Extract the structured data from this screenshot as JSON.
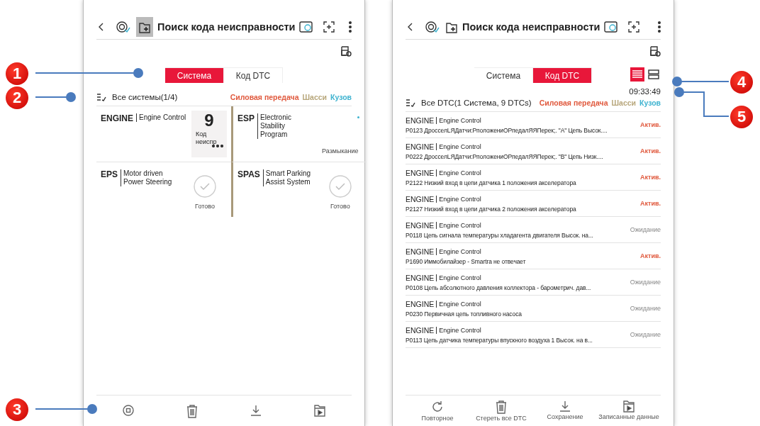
{
  "screens": [
    {
      "title": "Поиск кода неисправности",
      "doc_icon_highlighted": true,
      "tabs": [
        {
          "label": "Система",
          "selected": true
        },
        {
          "label": "Код DTC",
          "selected": false
        }
      ],
      "summary": "Все системы(1/4)",
      "categories": [
        {
          "label": "Силовая передача",
          "color": "#e0583c"
        },
        {
          "label": "Шасси",
          "color": "#b7a67a"
        },
        {
          "label": "Кузов",
          "color": "#3cb2cf"
        }
      ],
      "systems": [
        {
          "kind": "count",
          "code": "ENGINE",
          "name": "Engine Control",
          "count": "9",
          "caption": "Код неиспр"
        },
        {
          "kind": "status",
          "code": "ESP",
          "name": "Electronic Stability Program",
          "status": "Размыкание"
        },
        {
          "kind": "ready",
          "code": "EPS",
          "name": "Motor driven Power Steering",
          "status": "Готово"
        },
        {
          "kind": "ready",
          "code": "SPAS",
          "name": "Smart Parking Assist System",
          "status": "Готово"
        }
      ],
      "toolbar": [
        {
          "kind": "stop"
        },
        {
          "kind": "trash"
        },
        {
          "kind": "download"
        },
        {
          "kind": "folder"
        }
      ]
    },
    {
      "title": "Поиск кода неисправности",
      "doc_icon_highlighted": false,
      "tabs": [
        {
          "label": "Система",
          "selected": false
        },
        {
          "label": "Код DTC",
          "selected": true
        }
      ],
      "view_modes": [
        {
          "kind": "list",
          "selected": true
        },
        {
          "kind": "cards",
          "selected": false
        }
      ],
      "time": "09:33:49",
      "summary": "Все DTC(1 Система, 9 DTCs)",
      "categories": [
        {
          "label": "Силовая передача",
          "color": "#e0583c"
        },
        {
          "label": "Шасси",
          "color": "#b7a67a"
        },
        {
          "label": "Кузов",
          "color": "#3cb2cf"
        }
      ],
      "dtcs": [
        {
          "code": "ENGINE",
          "name": "Engine Control",
          "text": "P0123 ДросселLЯДатчи:РположениОРпедалЯЯПерек;. \"A\" Цепь Высок....",
          "status": "Актив.",
          "active": true
        },
        {
          "code": "ENGINE",
          "name": "Engine Control",
          "text": "P0222 ДросселLЯДатчи:РположениОРпедалЯЯПерек;. \"B\" Цепь Низк....",
          "status": "Актив.",
          "active": true
        },
        {
          "code": "ENGINE",
          "name": "Engine Control",
          "text": "P2122 Низкий вход в цепи датчика 1 положения акселератора",
          "status": "Актив.",
          "active": true
        },
        {
          "code": "ENGINE",
          "name": "Engine Control",
          "text": "P2127 Низкий вход в цепи датчика 2 положения акселератора",
          "status": "Актив.",
          "active": true
        },
        {
          "code": "ENGINE",
          "name": "Engine Control",
          "text": "P0118 Цепь сигнала температуры хладагента двигателя Высок. на...",
          "status": "Ожидание",
          "active": false
        },
        {
          "code": "ENGINE",
          "name": "Engine Control",
          "text": "P1690 Иммобилайзер - Smartra не отвечает",
          "status": "Актив.",
          "active": true
        },
        {
          "code": "ENGINE",
          "name": "Engine Control",
          "text": "P0108 Цепь абсолютного давления коллектора - барометрич. дав...",
          "status": "Ожидание",
          "active": false
        },
        {
          "code": "ENGINE",
          "name": "Engine Control",
          "text": "P0230 Первичная цепь топливного насоса",
          "status": "Ожидание",
          "active": false
        },
        {
          "code": "ENGINE",
          "name": "Engine Control",
          "text": "P0113 Цепь датчика температуры впускного воздуха 1 Высок. на в...",
          "status": "Ожидание",
          "active": false
        }
      ],
      "toolbar": [
        {
          "kind": "refresh",
          "label": "Повторное"
        },
        {
          "kind": "trash",
          "label": "Стереть все DTC"
        },
        {
          "kind": "download",
          "label": "Сохранение"
        },
        {
          "kind": "folder",
          "label": "Записанные данные"
        }
      ]
    }
  ],
  "callouts": [
    {
      "number": "1"
    },
    {
      "number": "2"
    },
    {
      "number": "3"
    },
    {
      "number": "4"
    },
    {
      "number": "5"
    }
  ]
}
